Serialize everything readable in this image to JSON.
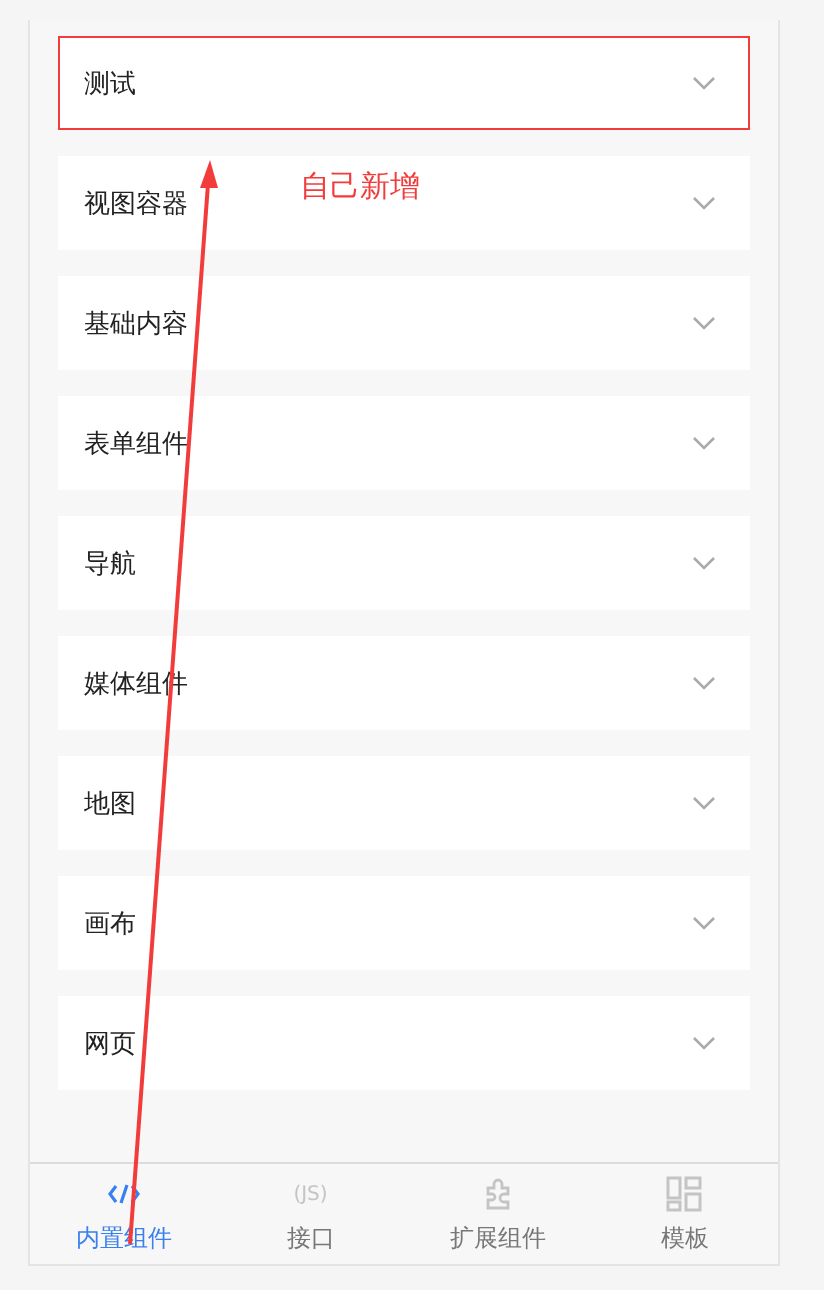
{
  "sections": [
    {
      "title": "测试",
      "expanded": false,
      "highlighted": true
    },
    {
      "title": "视图容器",
      "expanded": false,
      "highlighted": false
    },
    {
      "title": "基础内容",
      "expanded": false,
      "highlighted": false
    },
    {
      "title": "表单组件",
      "expanded": false,
      "highlighted": false
    },
    {
      "title": "导航",
      "expanded": false,
      "highlighted": false
    },
    {
      "title": "媒体组件",
      "expanded": false,
      "highlighted": false
    },
    {
      "title": "地图",
      "expanded": false,
      "highlighted": false
    },
    {
      "title": "画布",
      "expanded": false,
      "highlighted": false
    },
    {
      "title": "网页",
      "expanded": false,
      "highlighted": false
    }
  ],
  "annotation": {
    "text": "自己新增"
  },
  "tabs": [
    {
      "label": "内置组件",
      "kind": "code",
      "selected": true
    },
    {
      "label": "接口",
      "kind": "js",
      "icon_text": "(JS)",
      "selected": false
    },
    {
      "label": "扩展组件",
      "kind": "puzzle",
      "selected": false
    },
    {
      "label": "模板",
      "kind": "grid",
      "selected": false
    }
  ]
}
